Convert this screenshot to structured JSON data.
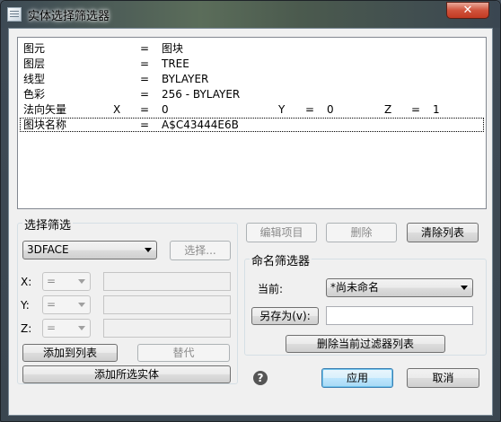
{
  "window": {
    "title": "实体选择筛选器",
    "close_label": "✕"
  },
  "list": {
    "rows": [
      {
        "name": "图元",
        "eq": "=",
        "value": "图块"
      },
      {
        "name": "图层",
        "eq": "=",
        "value": "TREE"
      },
      {
        "name": "线型",
        "eq": "=",
        "value": "BYLAYER"
      },
      {
        "name": "色彩",
        "eq": "=",
        "value": "256 - BYLAYER"
      },
      {
        "name": "法向矢量",
        "x_label": "X",
        "eq": "=",
        "value": "0",
        "y_label": "Y",
        "y_eq": "=",
        "y_value": "0",
        "z_label": "Z",
        "z_eq": "=",
        "z_value": "1"
      },
      {
        "name": "图块名称",
        "eq": "=",
        "value": "A$C43444E6B"
      }
    ]
  },
  "select_filter": {
    "title": "选择筛选",
    "type_combo": "3DFACE",
    "select_button": "选择...",
    "x_label": "X:",
    "x_op": "=",
    "y_label": "Y:",
    "y_op": "=",
    "z_label": "Z:",
    "z_op": "=",
    "add_to_list_button": "添加到列表",
    "replace_button": "替代",
    "add_selected_button": "添加所选实体"
  },
  "toolbar": {
    "edit_item_button": "编辑项目",
    "delete_button": "删除",
    "clear_list_button": "清除列表"
  },
  "named_filter": {
    "title": "命名筛选器",
    "current_label": "当前:",
    "current_value": "*尚未命名",
    "save_as_button": "另存为(v):",
    "save_as_value": "",
    "delete_current_button": "删除当前过滤器列表"
  },
  "footer": {
    "help_icon": "?",
    "apply_button": "应用",
    "cancel_button": "取消"
  }
}
